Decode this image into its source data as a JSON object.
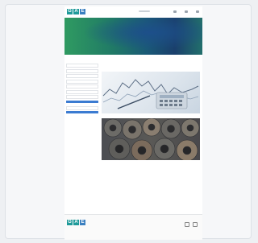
{
  "header": {
    "logo_letters": [
      "G",
      "A",
      "E"
    ],
    "links": [
      "",
      "",
      ""
    ]
  },
  "breadcrumb": "",
  "sidebar": {
    "section1_title": "",
    "items": [
      "",
      "",
      "",
      "",
      "",
      "",
      ""
    ],
    "button_label": "",
    "section2_title": "",
    "section2_items": [
      ""
    ],
    "section2_button": ""
  },
  "main": {
    "title": "",
    "news": [
      {
        "caption": ""
      },
      {
        "caption": ""
      }
    ]
  },
  "footer": {
    "logo_letters": [
      "G",
      "A",
      "E"
    ],
    "links": [
      "",
      "",
      "",
      "",
      ""
    ],
    "copyright": ""
  }
}
